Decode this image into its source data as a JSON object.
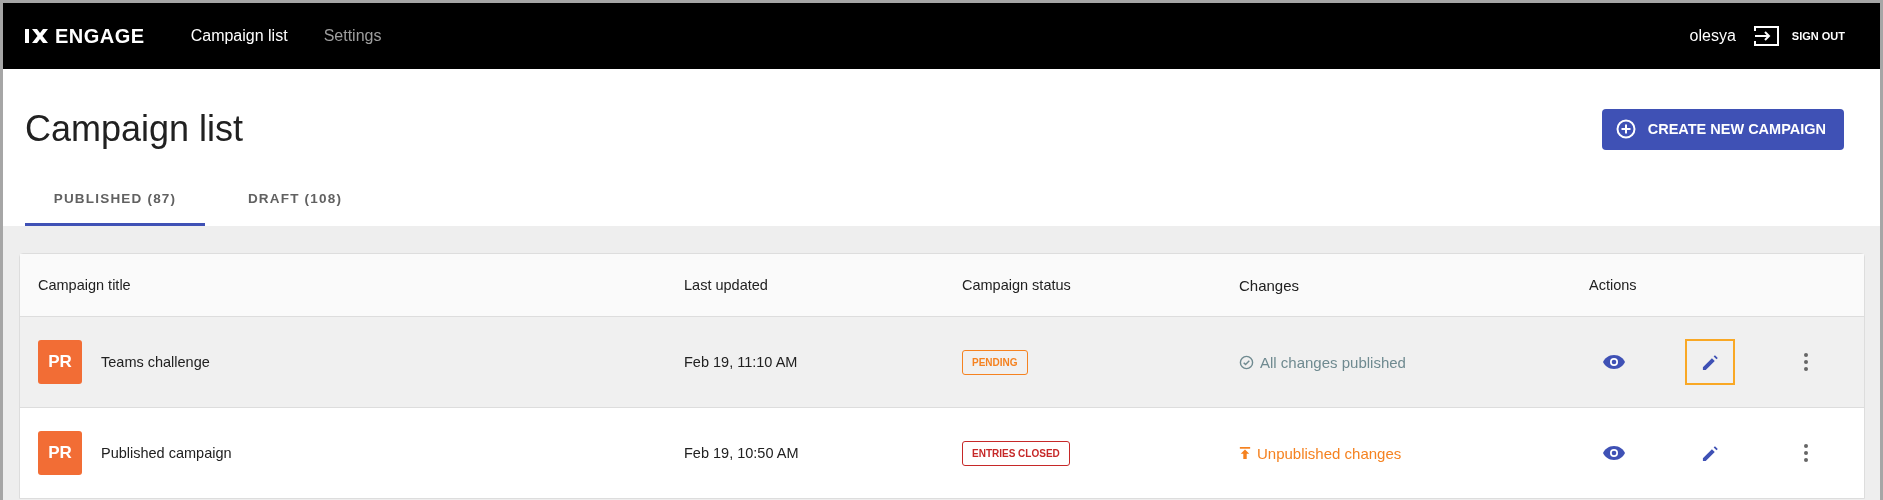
{
  "nav": {
    "logo": "ENGAGE",
    "links": [
      {
        "label": "Campaign list",
        "selected": true
      },
      {
        "label": "Settings",
        "selected": false
      }
    ],
    "user": "olesya",
    "sign_out": "SIGN OUT"
  },
  "page": {
    "title": "Campaign list",
    "create_button": "CREATE NEW CAMPAIGN"
  },
  "tabs": [
    {
      "label": "PUBLISHED (87)",
      "selected": true
    },
    {
      "label": "DRAFT (108)",
      "selected": false
    }
  ],
  "table": {
    "columns": [
      "Campaign title",
      "Last updated",
      "Campaign status",
      "Changes",
      "Actions"
    ],
    "rows": [
      {
        "badge": "PR",
        "title": "Teams challenge",
        "updated": "Feb 19, 11:10 AM",
        "status": {
          "kind": "pending",
          "label": "PENDING"
        },
        "changes": {
          "kind": "published",
          "label": "All changes published"
        },
        "highlighted": true,
        "edit_focused": true
      },
      {
        "badge": "PR",
        "title": "Published campaign",
        "updated": "Feb 19, 10:50 AM",
        "status": {
          "kind": "closed",
          "label": "ENTRIES CLOSED"
        },
        "changes": {
          "kind": "unpublished",
          "label": "Unpublished changes"
        },
        "highlighted": false,
        "edit_focused": false
      }
    ]
  }
}
